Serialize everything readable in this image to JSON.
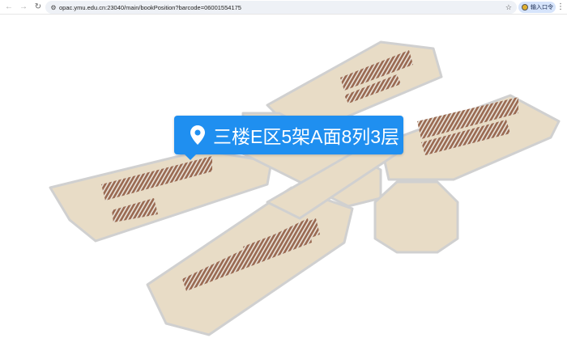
{
  "browser": {
    "url": "opac.ymu.edu.cn:23040/main/bookPosition?barcode=06001554175",
    "extension_label": "输入口令",
    "icons": [
      "back-icon",
      "forward-icon",
      "reload-icon",
      "site-settings-icon",
      "bookmark-star-icon",
      "more-menu-icon"
    ]
  },
  "map": {
    "location_label": "三楼E区5架A面8列3层",
    "accent": "#1f8ff0",
    "floor_color": "#e8dcc6",
    "wall_color": "#f4f4f4",
    "shelf_color": "#9a6a52"
  }
}
